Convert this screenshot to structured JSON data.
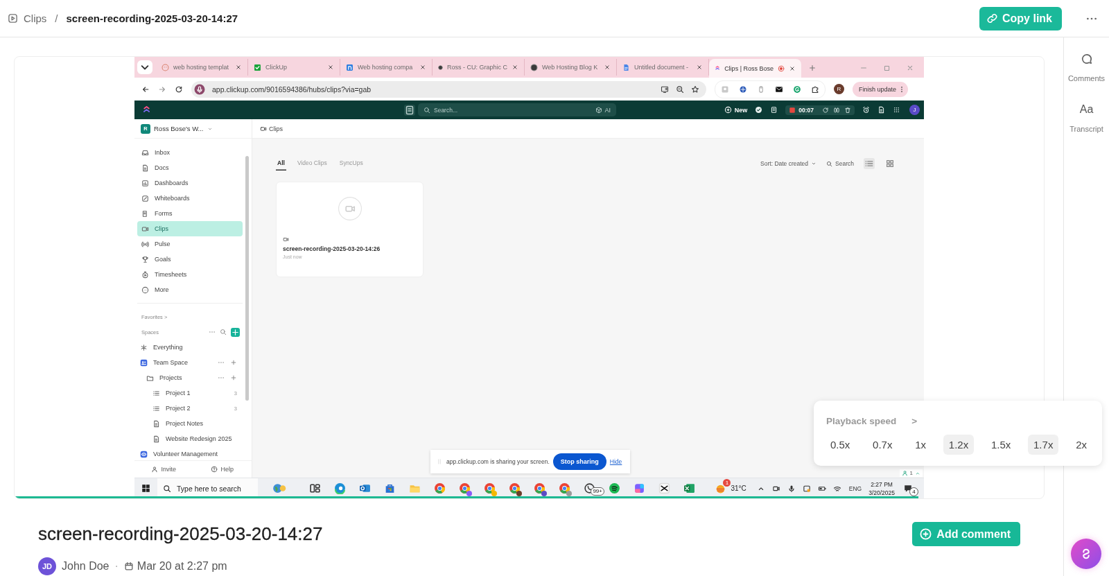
{
  "header": {
    "parent": "Clips",
    "separator": "/",
    "title": "screen-recording-2025-03-20-14:27",
    "copy_link": "Copy link"
  },
  "rail": [
    {
      "kind": "comments",
      "label": "Comments"
    },
    {
      "kind": "transcript",
      "glyph": "Aa",
      "label": "Transcript"
    }
  ],
  "video": {
    "progress": {
      "level": 0.878
    },
    "recording": {
      "browser": {
        "tabs": [
          {
            "kind": "globe",
            "title": "web hosting templat",
            "selected": false,
            "recording": false
          },
          {
            "kind": "check",
            "title": "ClickUp",
            "selected": false,
            "recording": false
          },
          {
            "kind": "notion",
            "title": "Web hosting compa",
            "selected": false,
            "recording": false
          },
          {
            "kind": "dark",
            "title": "Ross - CU: Graphic C",
            "selected": false,
            "recording": false
          },
          {
            "kind": "dark",
            "title": "Web Hosting Blog K",
            "selected": false,
            "recording": false
          },
          {
            "kind": "gdoc",
            "title": "Untitled document -",
            "selected": false,
            "recording": false
          },
          {
            "kind": "clickup",
            "title": "Clips | Ross Bose",
            "selected": true,
            "recording": true
          }
        ],
        "url": "app.clickup.com/9016594386/hubs/clips?via=gab",
        "profile": "R",
        "finish_update": "Finish update"
      },
      "app_bar": {
        "search": {
          "placeholder": "Search..."
        },
        "ai": "AI",
        "new": "New",
        "timer": "00:07",
        "avatar": "J"
      },
      "sidebar": {
        "workspace_initial": "R",
        "workspace": "Ross Bose's W...",
        "nav": [
          {
            "kind": "inbox",
            "label": "Inbox",
            "selected": false
          },
          {
            "kind": "docs",
            "label": "Docs",
            "selected": false
          },
          {
            "kind": "dashboards",
            "label": "Dashboards",
            "selected": false
          },
          {
            "kind": "whiteboards",
            "label": "Whiteboards",
            "selected": false
          },
          {
            "kind": "forms",
            "label": "Forms",
            "selected": false
          },
          {
            "kind": "clips",
            "label": "Clips",
            "selected": true
          },
          {
            "kind": "pulse",
            "label": "Pulse",
            "selected": false
          },
          {
            "kind": "goals",
            "label": "Goals",
            "selected": false
          },
          {
            "kind": "timesheets",
            "label": "Timesheets",
            "selected": false
          },
          {
            "kind": "more",
            "label": "More",
            "selected": false
          }
        ],
        "favorites": "Favorites >",
        "spaces_title": "Spaces",
        "spaces": [
          {
            "kind": "everything",
            "label": "Everything"
          },
          {
            "kind": "team",
            "label": "Team Space",
            "children": [
              {
                "kind": "folder",
                "label": "Projects",
                "children": [
                  {
                    "kind": "list",
                    "label": "Project 1",
                    "count": "3"
                  },
                  {
                    "kind": "list",
                    "label": "Project 2",
                    "count": "3"
                  },
                  {
                    "kind": "doc",
                    "label": "Project Notes"
                  },
                  {
                    "kind": "doc",
                    "label": "Website Redesign 2025"
                  }
                ]
              }
            ]
          },
          {
            "kind": "volunteer",
            "label": "Volunteer Management"
          }
        ],
        "footer": [
          {
            "kind": "invite",
            "label": "Invite"
          },
          {
            "kind": "help",
            "label": "Help"
          }
        ]
      },
      "content": {
        "breadcrumb": "Clips",
        "tabs": [
          {
            "label": "All",
            "selected": true
          },
          {
            "label": "Video Clips",
            "selected": false
          },
          {
            "label": "SyncUps",
            "selected": false
          }
        ],
        "sort": "Sort: Date created",
        "search": "Search",
        "views": [
          {
            "kind": "list",
            "selected": true
          },
          {
            "kind": "grid",
            "selected": false
          }
        ],
        "clips": [
          {
            "title": "screen-recording-2025-03-20-14:26",
            "time": "Just now"
          }
        ]
      },
      "share_bar": {
        "message": "app.clickup.com is sharing your screen.",
        "stop": "Stop sharing",
        "hide": "Hide"
      },
      "presence": "1",
      "taskbar": {
        "search": {
          "placeholder": "Type here to search"
        },
        "apps": [
          {
            "kind": "widgets"
          },
          {
            "kind": "task-view"
          },
          {
            "kind": "edge"
          },
          {
            "kind": "outlook"
          },
          {
            "kind": "store"
          },
          {
            "kind": "explorer"
          },
          {
            "kind": "chrome"
          },
          {
            "kind": "chrome",
            "color": "#8a5cf6"
          },
          {
            "kind": "chrome",
            "color": "#f5b800"
          },
          {
            "kind": "chrome",
            "color": "#6b3f2a"
          },
          {
            "kind": "chrome",
            "color": "#5b4bc4"
          },
          {
            "kind": "chrome",
            "color": "#9a9a9a"
          },
          {
            "kind": "whatsapp",
            "badge": "99+"
          },
          {
            "kind": "spotify"
          },
          {
            "kind": "copilot"
          },
          {
            "kind": "capcut"
          },
          {
            "kind": "excel"
          }
        ],
        "weather": {
          "badge": "1",
          "temp": "31°C"
        },
        "lang": "ENG",
        "time": "2:27 PM",
        "date": "3/20/2025",
        "notifications": "4"
      }
    }
  },
  "playback_speed": {
    "label": "Playback speed",
    "arrow": ">",
    "options": [
      {
        "label": "0.5x",
        "selected": false
      },
      {
        "label": "0.7x",
        "selected": false
      },
      {
        "label": "1x",
        "selected": false
      },
      {
        "label": "1.2x",
        "selected": true
      },
      {
        "label": "1.5x",
        "selected": false
      },
      {
        "label": "1.7x",
        "selected": true
      },
      {
        "label": "2x",
        "selected": false
      }
    ]
  },
  "clip": {
    "title": "screen-recording-2025-03-20-14:27",
    "add_comment": "Add comment",
    "author_initials": "JD",
    "author": "John Doe",
    "separator": "·",
    "date": "Mar 20 at 2:27 pm"
  }
}
